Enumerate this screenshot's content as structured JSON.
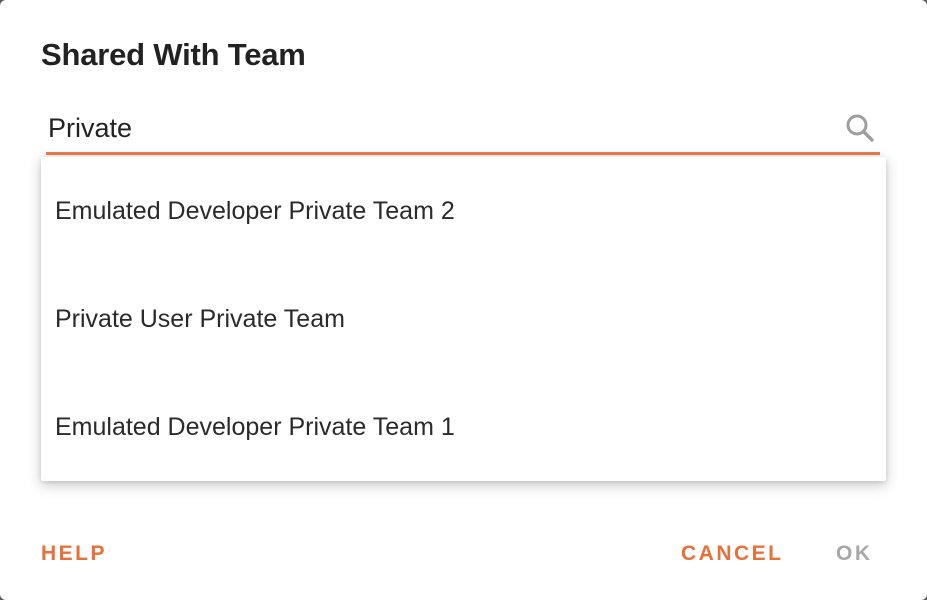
{
  "dialog": {
    "title": "Shared With Team"
  },
  "search": {
    "value": "Private",
    "placeholder": ""
  },
  "dropdown": {
    "options": [
      {
        "label": "Emulated Developer Private Team 2"
      },
      {
        "label": "Private User Private Team"
      },
      {
        "label": "Emulated Developer Private Team 1"
      }
    ]
  },
  "actions": {
    "help_label": "HELP",
    "cancel_label": "CANCEL",
    "ok_label": "OK"
  },
  "colors": {
    "accent": "#e8703a",
    "underline": "#ee7a4b",
    "disabled": "#a8a8a8"
  },
  "icons": {
    "search": "search-icon"
  }
}
